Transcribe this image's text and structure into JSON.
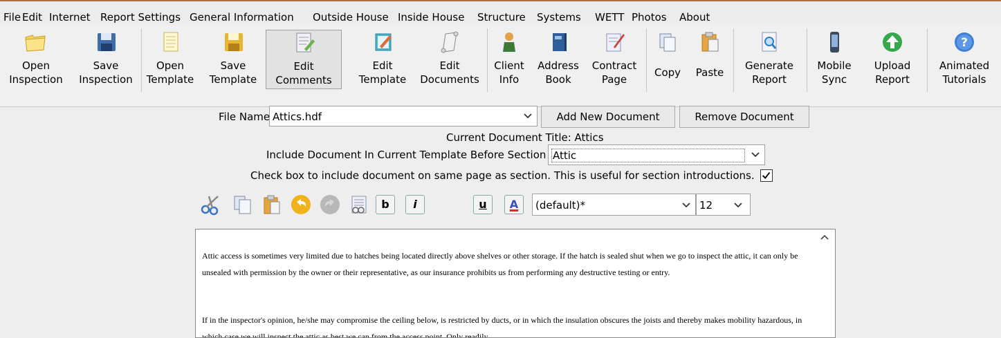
{
  "menu": [
    "File",
    "Edit",
    "Internet",
    "Report Settings",
    "General Information",
    "Outside House",
    "Inside House",
    "Structure",
    "Systems",
    "WETT",
    "Photos",
    "About"
  ],
  "toolbar": [
    {
      "name": "open-inspection",
      "line1": "Open",
      "line2": "Inspection",
      "icon": "folder-icon"
    },
    {
      "name": "save-inspection",
      "line1": "Save",
      "line2": "Inspection",
      "icon": "floppy-disk-icon"
    },
    {
      "name": "open-template",
      "line1": "Open",
      "line2": "Template",
      "icon": "template-document-icon"
    },
    {
      "name": "save-template",
      "line1": "Save",
      "line2": "Template",
      "icon": "floppy-disk-yellow-icon"
    },
    {
      "name": "edit-comments",
      "line1": "Edit",
      "line2": "Comments",
      "icon": "edit-comments-icon"
    },
    {
      "name": "edit-template",
      "line1": "Edit",
      "line2": "Template",
      "icon": "edit-template-icon"
    },
    {
      "name": "edit-documents",
      "line1": "Edit",
      "line2": "Documents",
      "icon": "scroll-icon"
    },
    {
      "name": "client-info",
      "line1": "Client",
      "line2": "Info",
      "icon": "person-icon"
    },
    {
      "name": "address-book",
      "line1": "Address",
      "line2": "Book",
      "icon": "address-book-icon"
    },
    {
      "name": "contract-page",
      "line1": "Contract",
      "line2": "Page",
      "icon": "contract-icon"
    },
    {
      "name": "copy",
      "line1": "Copy",
      "line2": "",
      "icon": "copy-icon"
    },
    {
      "name": "paste",
      "line1": "Paste",
      "line2": "",
      "icon": "paste-icon"
    },
    {
      "name": "generate-report",
      "line1": "Generate",
      "line2": "Report",
      "icon": "magnify-document-icon"
    },
    {
      "name": "mobile-sync",
      "line1": "Mobile",
      "line2": "Sync",
      "icon": "phone-icon"
    },
    {
      "name": "upload-report",
      "line1": "Upload",
      "line2": "Report",
      "icon": "upload-arrow-icon"
    },
    {
      "name": "animated-tutorials",
      "line1": "Animated",
      "line2": "Tutorials",
      "icon": "help-icon"
    }
  ],
  "document": {
    "file_name_label": "File Name",
    "file_name_value": "Attics.hdf",
    "add_button": "Add New Document",
    "remove_button": "Remove Document",
    "current_title": "Current Document Title: Attics",
    "include_label": "Include Document In Current Template Before Section",
    "section_value": "Attic",
    "checkbox_label": "Check box to include document on same page as section. This is useful for section introductions.",
    "same_page_checked": true
  },
  "format": {
    "bold": "b",
    "italic": "i",
    "underline": "u",
    "color": "A",
    "font_value": "(default)*",
    "size_value": "12"
  },
  "editor": {
    "para1": "Attic access is sometimes very limited due to hatches being located directly above shelves or other storage. If the hatch is sealed shut when we go to inspect the attic, it can only be unsealed with permission by the owner or their representative, as our insurance prohibits us from performing any destructive testing or entry.",
    "para2": "If in the inspector's opinion, he/she may compromise the ceiling below, is restricted by ducts, or in which the insulation obscures the joists and thereby makes mobility hazardous, in which case we will inspect the attic as best we can from the access point. Only readily"
  }
}
